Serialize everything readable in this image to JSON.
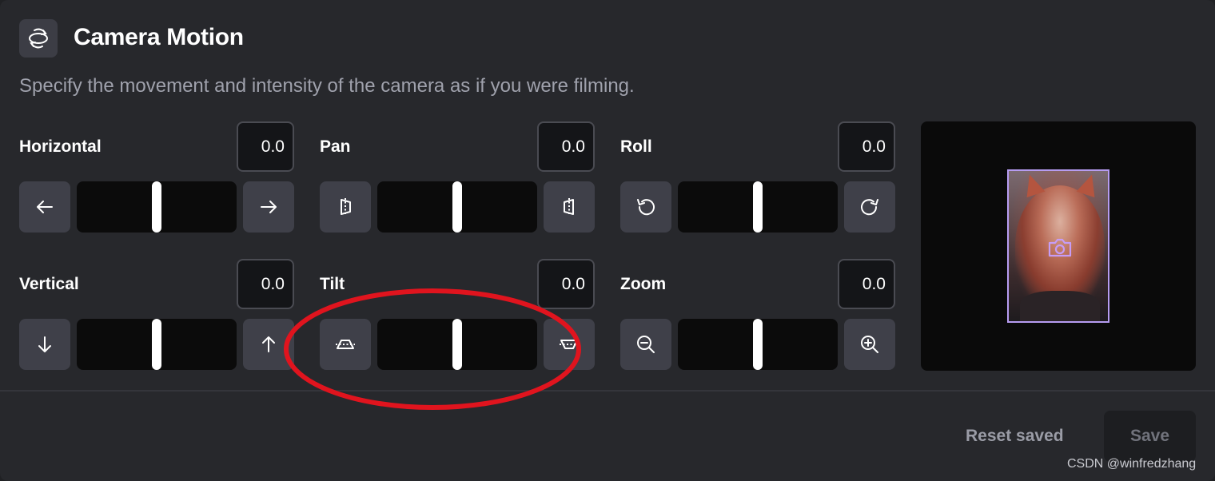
{
  "header": {
    "icon": "camera-motion-icon",
    "title": "Camera Motion",
    "description": "Specify the movement and intensity of the camera as if you were filming."
  },
  "controls": [
    {
      "id": "horizontal",
      "label": "Horizontal",
      "value": "0.0",
      "left_icon": "arrow-left-icon",
      "right_icon": "arrow-right-icon",
      "position": 0.5
    },
    {
      "id": "pan",
      "label": "Pan",
      "value": "0.0",
      "left_icon": "pan-left-icon",
      "right_icon": "pan-right-icon",
      "position": 0.5
    },
    {
      "id": "roll",
      "label": "Roll",
      "value": "0.0",
      "left_icon": "rotate-ccw-icon",
      "right_icon": "rotate-cw-icon",
      "position": 0.5
    },
    {
      "id": "vertical",
      "label": "Vertical",
      "value": "0.0",
      "left_icon": "arrow-down-icon",
      "right_icon": "arrow-up-icon",
      "position": 0.5
    },
    {
      "id": "tilt",
      "label": "Tilt",
      "value": "0.0",
      "left_icon": "tilt-down-icon",
      "right_icon": "tilt-up-icon",
      "position": 0.5
    },
    {
      "id": "zoom",
      "label": "Zoom",
      "value": "0.0",
      "left_icon": "zoom-out-icon",
      "right_icon": "zoom-in-icon",
      "position": 0.5
    }
  ],
  "preview": {
    "overlay_icon": "camera-icon"
  },
  "footer": {
    "reset_label": "Reset saved",
    "save_label": "Save"
  },
  "watermark": "CSDN @winfredzhang",
  "colors": {
    "background": "#27282c",
    "button": "#3f4049",
    "track": "#0b0b0b",
    "accent": "#b69cf1",
    "annotation": "#e0141e"
  }
}
